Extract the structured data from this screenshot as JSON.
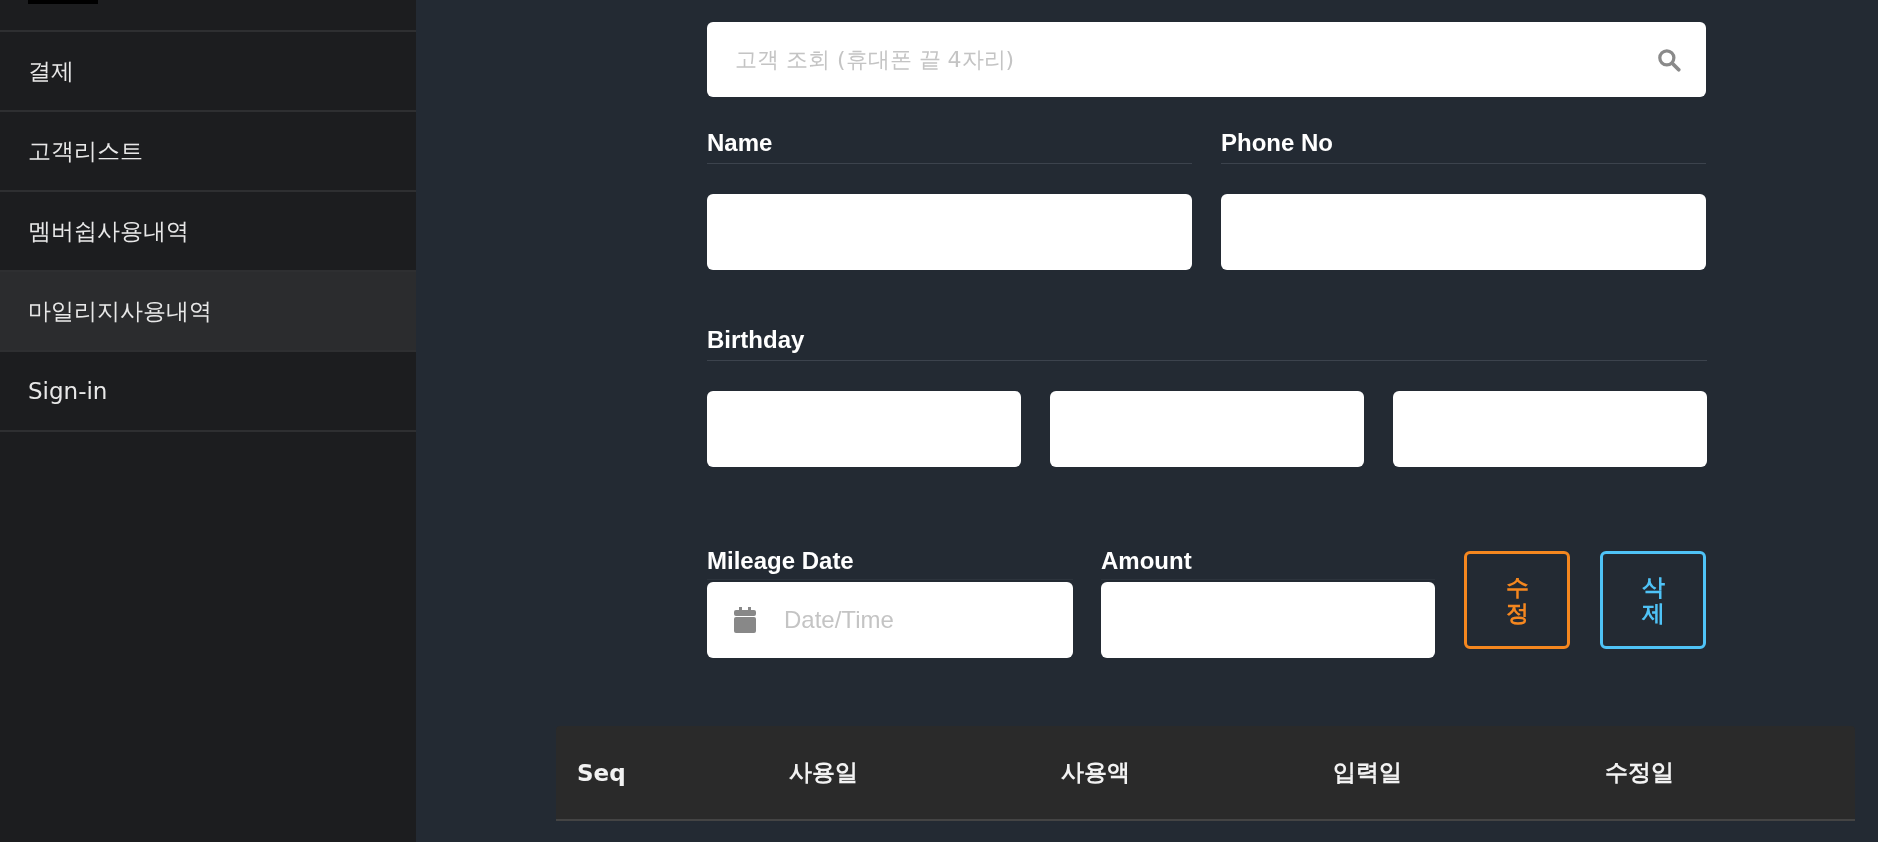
{
  "sidebar": {
    "items": [
      {
        "label": "결제",
        "selected": false
      },
      {
        "label": "고객리스트",
        "selected": false
      },
      {
        "label": "멤버쉽사용내역",
        "selected": false
      },
      {
        "label": "마일리지사용내역",
        "selected": true
      },
      {
        "label": "Sign-in",
        "selected": false
      }
    ]
  },
  "search": {
    "placeholder": "고객 조회 (휴대폰 끝 4자리)"
  },
  "customer": [
    {
      "label": "Name",
      "fields": [
        {
          "kind": "text"
        }
      ]
    },
    {
      "label": "Phone No",
      "fields": [
        {
          "kind": "text"
        }
      ]
    }
  ],
  "birthday": {
    "label": "Birthday",
    "fields": [
      {
        "kind": "text"
      },
      {
        "kind": "text"
      },
      {
        "kind": "text"
      }
    ]
  },
  "mileage": {
    "date": {
      "label": "Mileage Date",
      "placeholder": "Date/Time"
    },
    "amount": {
      "label": "Amount"
    }
  },
  "buttons": [
    {
      "label": "수정",
      "color": "#f5871f"
    },
    {
      "label": "삭제",
      "color": "#4fc3f7"
    }
  ],
  "table": {
    "columns": [
      "Seq",
      "사용일",
      "사용액",
      "입력일",
      "수정일"
    ]
  }
}
